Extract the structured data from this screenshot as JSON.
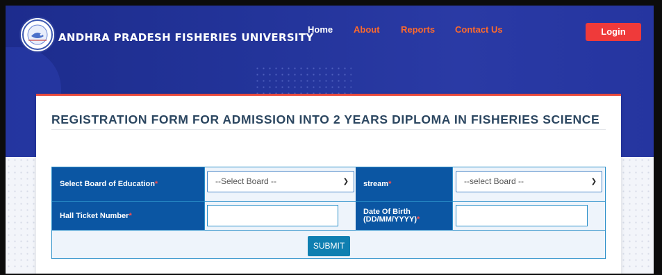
{
  "header": {
    "university_name": "ANDHRA PRADESH FISHERIES UNIVERSITY",
    "logo_icon": "university-seal-icon"
  },
  "nav": {
    "items": [
      {
        "label": "Home",
        "color": "#ffffff"
      },
      {
        "label": "About",
        "color": "#ff6a2b"
      },
      {
        "label": "Reports",
        "color": "#ff6a2b"
      },
      {
        "label": "Contact Us",
        "color": "#ff6a2b"
      }
    ],
    "login_label": "Login"
  },
  "form": {
    "title": "REGISTRATION FORM FOR ADMISSION INTO 2 YEARS DIPLOMA IN FISHERIES SCIENCE",
    "board_label": "Select Board of Education",
    "board_select_value": "--Select Board --",
    "stream_label": "stream",
    "stream_select_value": "--select Board --",
    "hall_ticket_label": "Hall Ticket Number",
    "dob_label_line1": "Date Of Birth",
    "dob_label_line2": "(DD/MM/YYYY)",
    "required_mark": "*",
    "submit_label": "SUBMIT"
  },
  "colors": {
    "header_bg": "#23349a",
    "accent_red": "#e84a3c",
    "label_bg": "#0b56a3",
    "submit_bg": "#0f7fb1",
    "nav_orange": "#ff6a2b"
  }
}
